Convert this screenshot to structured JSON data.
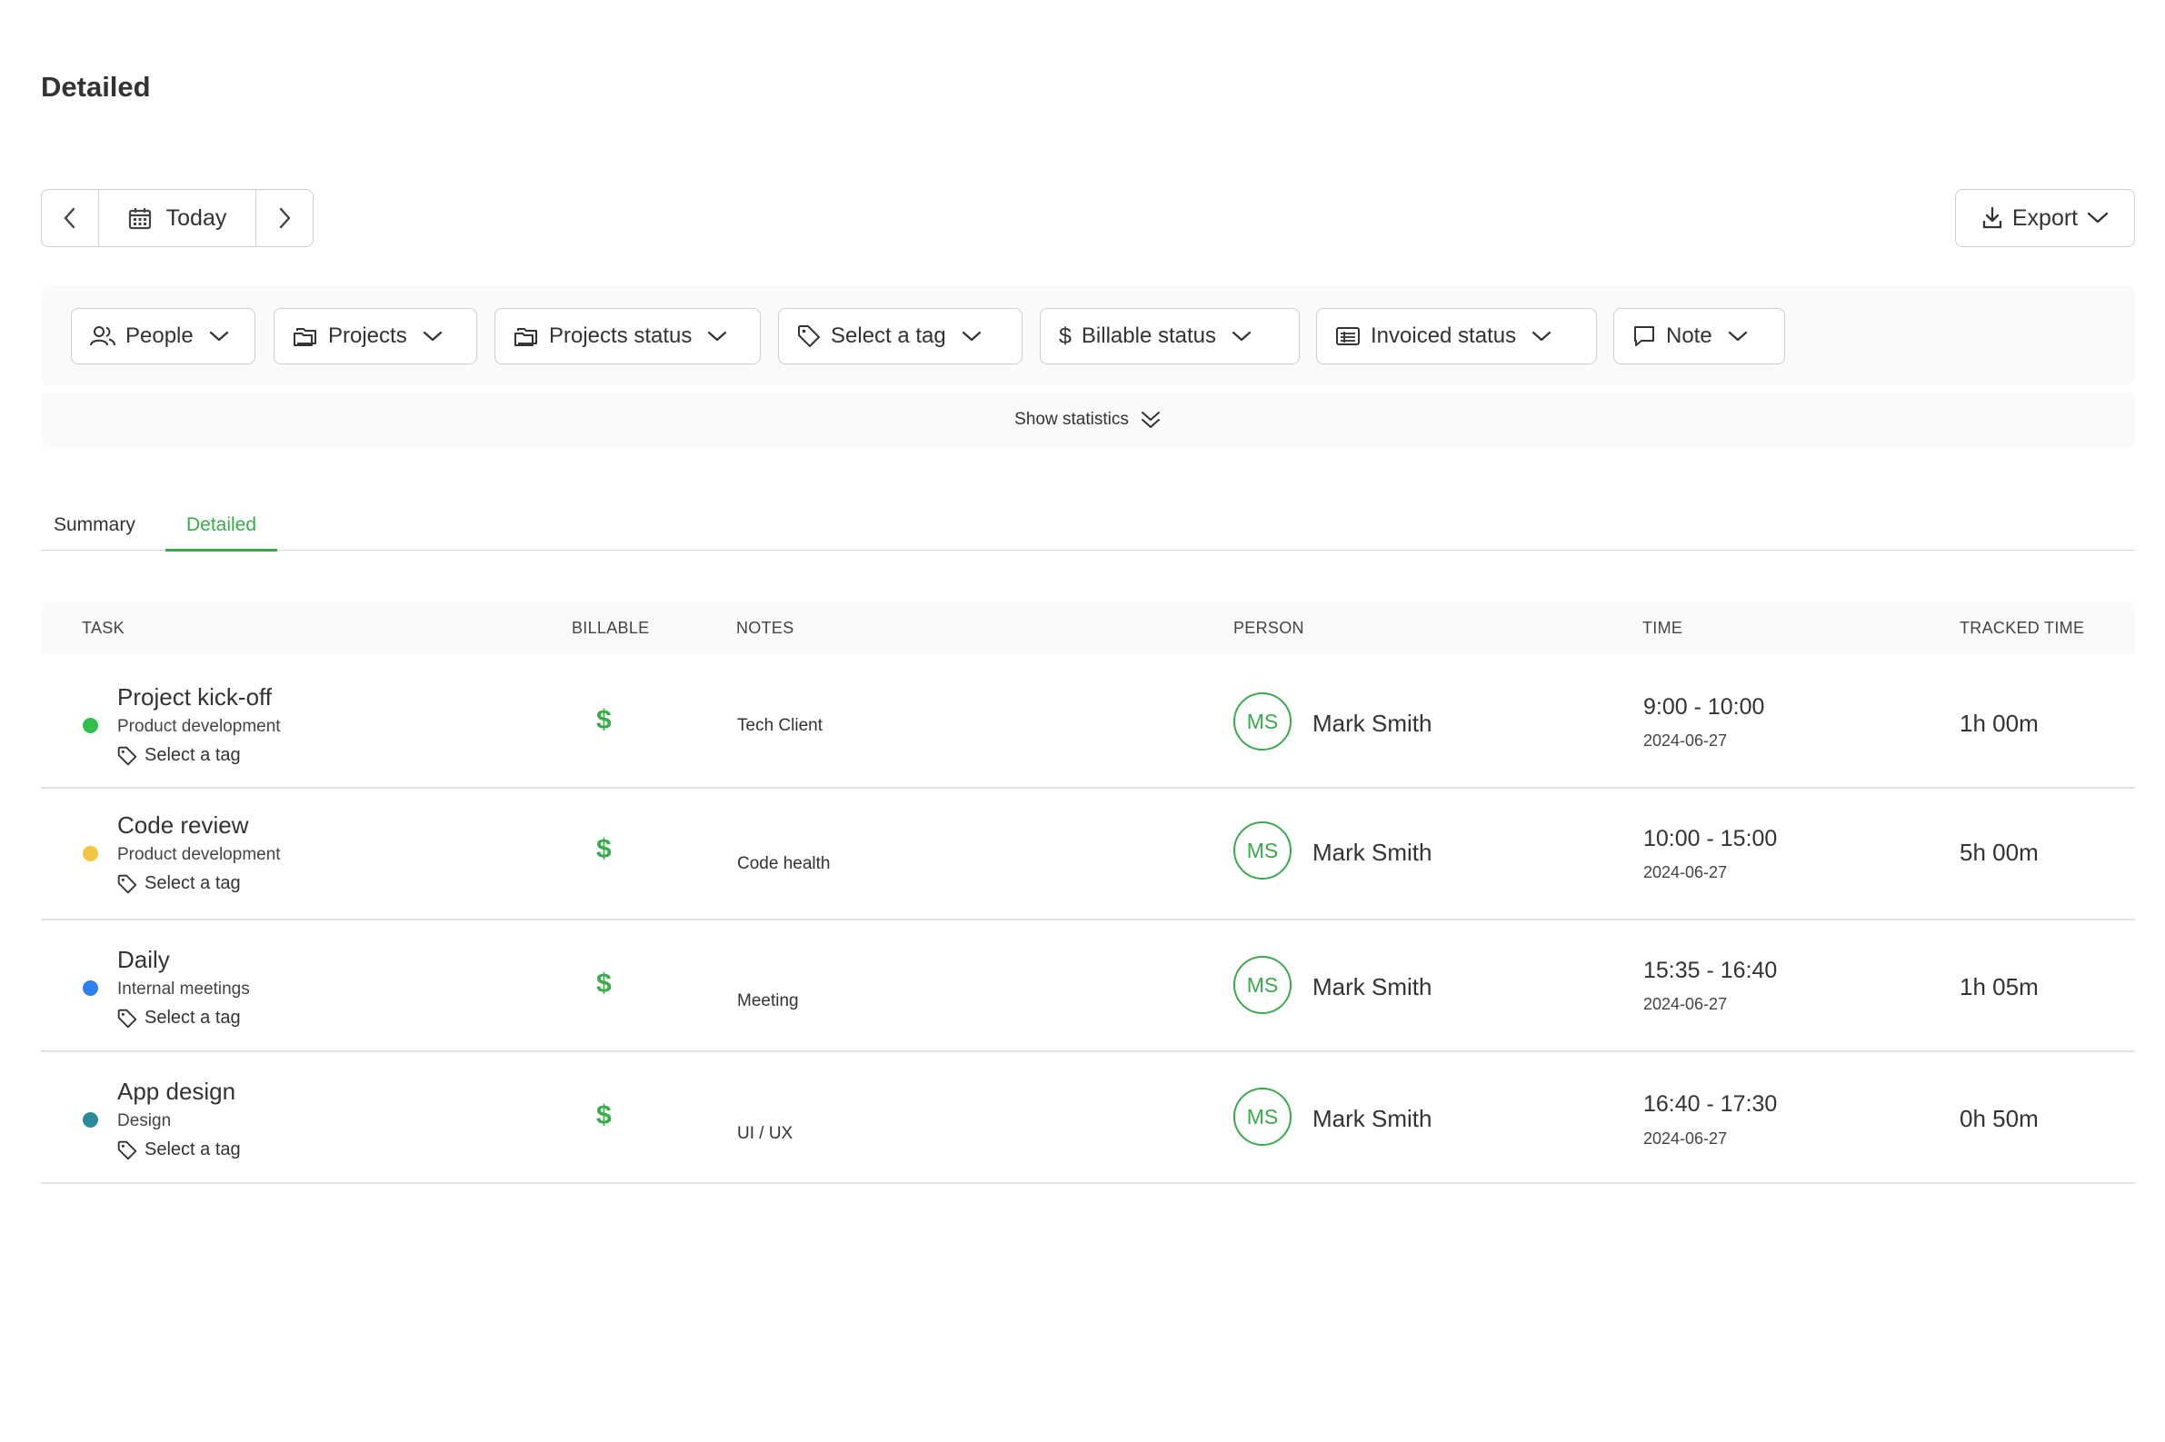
{
  "page": {
    "title": "Detailed"
  },
  "date_nav": {
    "label": "Today",
    "prev_icon": "chevron-left-icon",
    "next_icon": "chevron-right-icon",
    "calendar_icon": "calendar-icon"
  },
  "export": {
    "label": "Export"
  },
  "filters": [
    {
      "label": "People",
      "icon": "people-icon"
    },
    {
      "label": "Projects",
      "icon": "folder-icon"
    },
    {
      "label": "Projects status",
      "icon": "folders-icon"
    },
    {
      "label": "Select a tag",
      "icon": "tag-icon"
    },
    {
      "label": "Billable status",
      "icon": "dollar-icon"
    },
    {
      "label": "Invoiced status",
      "icon": "invoice-icon"
    },
    {
      "label": "Note",
      "icon": "note-icon"
    }
  ],
  "stats": {
    "label": "Show statistics"
  },
  "tabs": [
    {
      "label": "Summary",
      "active": false
    },
    {
      "label": "Detailed",
      "active": true
    }
  ],
  "columns": [
    "TASK",
    "BILLABLE",
    "NOTES",
    "PERSON",
    "TIME",
    "TRACKED TIME"
  ],
  "rows": [
    {
      "task": "Project kick-off",
      "project": "Product development",
      "tag": "Select a tag",
      "dot_color": "#2fbf4a",
      "billable": "$",
      "note": "Tech Client",
      "initials": "MS",
      "person": "Mark Smith",
      "time": "9:00 - 10:00",
      "date": "2024-06-27",
      "tracked": "1h 00m"
    },
    {
      "task": "Code review",
      "project": "Product development",
      "tag": "Select a tag",
      "dot_color": "#f4c542",
      "billable": "$",
      "note": "Code health",
      "initials": "MS",
      "person": "Mark Smith",
      "time": "10:00 - 15:00",
      "date": "2024-06-27",
      "tracked": "5h 00m"
    },
    {
      "task": "Daily",
      "project": "Internal meetings",
      "tag": "Select a tag",
      "dot_color": "#2f7ff0",
      "billable": "$",
      "note": "Meeting",
      "initials": "MS",
      "person": "Mark Smith",
      "time": "15:35 - 16:40",
      "date": "2024-06-27",
      "tracked": "1h 05m"
    },
    {
      "task": "App design",
      "project": "Design",
      "tag": "Select a tag",
      "dot_color": "#2a8a9a",
      "billable": "$",
      "note": "UI / UX",
      "initials": "MS",
      "person": "Mark Smith",
      "time": "16:40 - 17:30",
      "date": "2024-06-27",
      "tracked": "0h 50m"
    }
  ],
  "colors": {
    "accent": "#3aaa4c",
    "border": "#cfcfcf",
    "panel": "#fafafa"
  }
}
